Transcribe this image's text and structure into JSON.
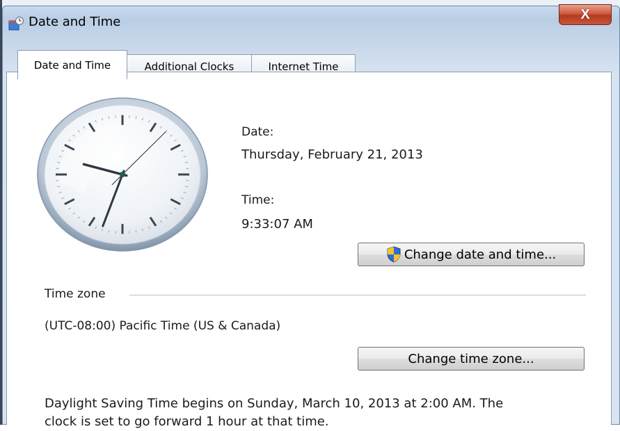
{
  "window": {
    "title": "Date and Time",
    "close_label": "X"
  },
  "tabs": [
    {
      "label": "Date and Time",
      "active": true
    },
    {
      "label": "Additional Clocks",
      "active": false
    },
    {
      "label": "Internet Time",
      "active": false
    }
  ],
  "clock": {
    "hour": 9,
    "minute": 33,
    "second": 7
  },
  "date": {
    "label": "Date:",
    "value": "Thursday, February 21, 2013"
  },
  "time": {
    "label": "Time:",
    "value": "9:33:07 AM"
  },
  "buttons": {
    "change_datetime": "Change date and time...",
    "change_timezone": "Change time zone..."
  },
  "timezone": {
    "group_label": "Time zone",
    "value": "(UTC-08:00) Pacific Time (US & Canada)"
  },
  "dst": {
    "line1": "Daylight Saving Time begins on Sunday, March 10, 2013 at 2:00 AM. The",
    "line2": "clock is set to go forward 1 hour at that time."
  },
  "icons": {
    "title": "date-time-icon",
    "shield": "uac-shield-icon"
  }
}
